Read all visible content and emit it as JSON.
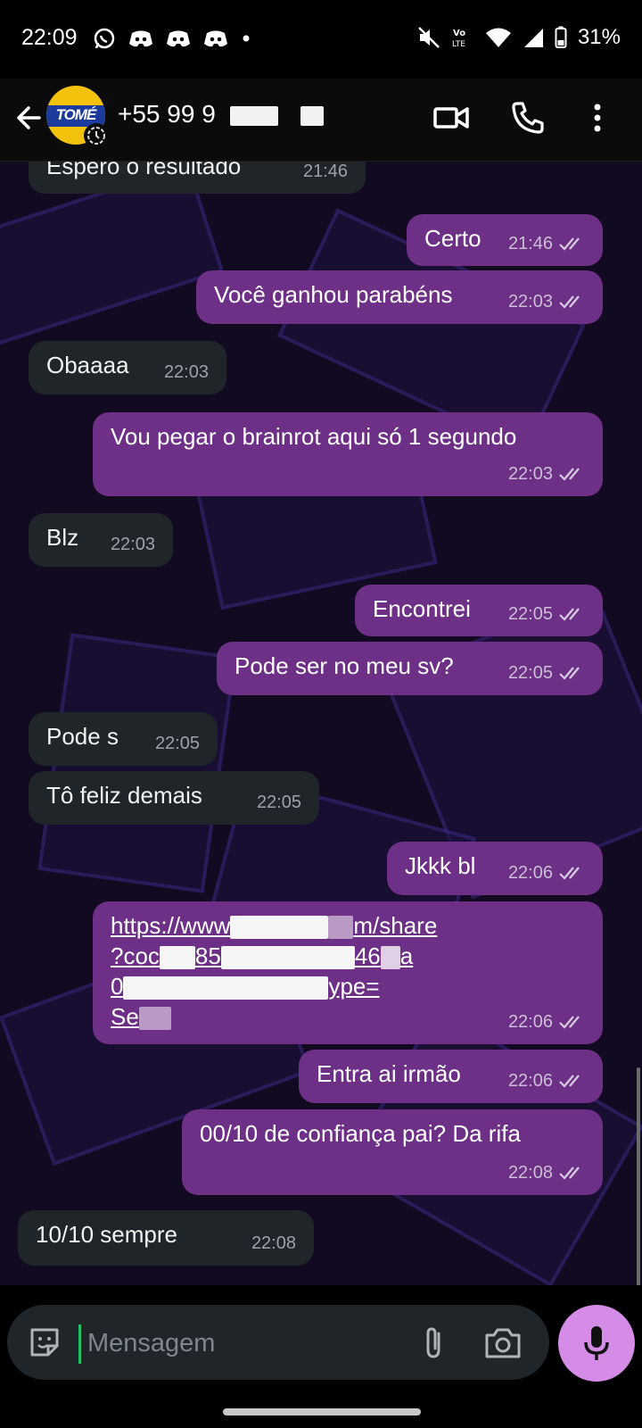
{
  "status_bar": {
    "time": "22:09",
    "battery": "31%",
    "network_label": "Vo LTE"
  },
  "header": {
    "contact_name": "+55 99 9",
    "avatar_text": "TOMÉ"
  },
  "messages": [
    {
      "dir": "in",
      "text": "Espero o resultado",
      "time": "21:46"
    },
    {
      "dir": "out",
      "text": "Certo",
      "time": "21:46"
    },
    {
      "dir": "out",
      "text": "Você ganhou parabéns",
      "time": "22:03"
    },
    {
      "dir": "in",
      "text": "Obaaaa",
      "time": "22:03"
    },
    {
      "dir": "out",
      "text": "Vou pegar o brainrot aqui só 1 segundo",
      "time": "22:03"
    },
    {
      "dir": "in",
      "text": "Blz",
      "time": "22:03"
    },
    {
      "dir": "out",
      "text": "Encontrei",
      "time": "22:05"
    },
    {
      "dir": "out",
      "text": "Pode ser no meu sv?",
      "time": "22:05"
    },
    {
      "dir": "in",
      "text": "Pode s",
      "time": "22:05"
    },
    {
      "dir": "in",
      "text": "Tô feliz demais",
      "time": "22:05"
    },
    {
      "dir": "out",
      "text": "Jkkk bl",
      "time": "22:06"
    },
    {
      "dir": "out",
      "link_lines": [
        "https://www",
        "m/share",
        "?coc",
        "85",
        "46",
        "a",
        "0",
        "ype=",
        "Se"
      ],
      "time": "22:06"
    },
    {
      "dir": "out",
      "text": "Entra ai irmão",
      "time": "22:06"
    },
    {
      "dir": "out",
      "text": "00/10 de confiança pai? Da rifa",
      "time": "22:08"
    },
    {
      "dir": "in",
      "text": "10/10 sempre",
      "time": "22:08"
    }
  ],
  "composer": {
    "placeholder": "Mensagem"
  },
  "colors": {
    "outgoing_bubble": "#6e2f86",
    "incoming_bubble": "#1f2529",
    "mic_button": "#d48ce6",
    "cursor": "#21c063"
  },
  "icons": [
    "back-arrow-icon",
    "video-call-icon",
    "voice-call-icon",
    "more-options-icon",
    "sticker-icon",
    "attach-icon",
    "camera-icon",
    "mic-icon",
    "whatsapp-icon",
    "discord-icon",
    "mute-icon",
    "wifi-icon",
    "signal-icon",
    "battery-icon"
  ]
}
